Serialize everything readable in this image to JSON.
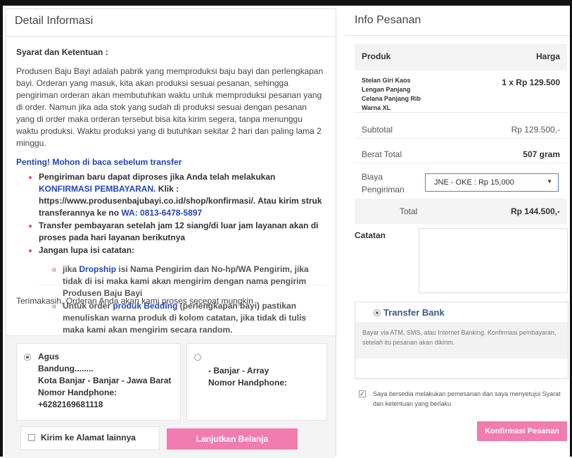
{
  "left_panel": {
    "title": "Detail Informasi",
    "syarat_heading": "Syarat dan Ketentuan :",
    "paragraph": "Produsen Baju Bayi adalah pabrik yang memproduksi baju bayi dan perlengkapan bayi. Orderan yang masuk, kita akan produksi sesuai pesanan, sehingga pengiriman orderan akan membutuhkan waktu untuk memproduksi pesanan yang di order. Namun jika ada stok yang sudah di produksi sesuai dengan pesanan yang di order maka orderan tersebut bisa kita kirim segera, tanpa menunggu waktu produksi. Waktu produksi yang di butuhkan sekitar 2 hari dan paling lama 2 minggu.",
    "penting": "Penting! Mohon di baca sebelum transfer",
    "rule1_a": "Pengiriman baru dapat diproses jika Anda telah melakukan ",
    "rule1_link": "KONFIRMASI PEMBAYARAN.",
    "rule1_b": " Klik : https://www.produsenbajubayi.co.id/shop/konfirmasi/. Atau kirim struk transferannya ke no ",
    "rule1_wa": "WA: 0813-6478-5897",
    "rule2": "Transfer pembayaran setelah jam 12 siang/di luar jam layanan akan di proses pada hari layanan berikutnya",
    "rule3": "Jangan lupa isi catatan:",
    "sub1_a": "jika ",
    "sub1_link": "Dropship",
    "sub1_b": " isi Nama Pengirim dan No-hp/WA Pengirim, jika tidak di isi maka kami akan mengirim dengan nama pengirim Produsen Baju Bayi",
    "sub2_a": "Untuk order ",
    "sub2_link": "produk Bedding",
    "sub2_b": " (perlengkapan bayi) pastikan menuliskan warna produk di kolom catatan, jika tidak di tulis maka kami akan mengirim secara random.",
    "thanks": "Terimakasih, Orderan Anda akan kami proses secepat mungkin"
  },
  "address1": {
    "name": "Agus",
    "line1": "Bandung........",
    "line2": "Kota Banjar - Banjar - Jawa Barat",
    "phone_label": "Nomor Handphone:",
    "phone": "+6282169681118"
  },
  "address2": {
    "line1": "- Banjar - Array",
    "phone_label": "Nomor Handphone:"
  },
  "kirim_label": "Kirim ke Alamat lainnya",
  "lanjutkan_label": "Lanjutkan Belanja",
  "right_panel": {
    "title": "Info Pesanan",
    "col_produk": "Produk",
    "col_harga": "Harga",
    "product_name": "Stelan Giri Kaos Lengan Panjang Celana Panjang Rib Warna XL",
    "product_price": "1 x Rp 129.500",
    "subtotal_label": "Subtotal",
    "subtotal_value": "Rp 129.500,-",
    "berat_label": "Berat Total",
    "berat_value": "507 gram",
    "biaya_label": "Biaya Pengiriman",
    "shipping_selected": "JNE - OKE : Rp 15,000",
    "total_label": "Total",
    "total_value": "Rp 144.500,-",
    "catatan_label": "Catatan",
    "transfer_label": "Transfer Bank",
    "transfer_desc": "Bayar via ATM, SMS, atau Internet Banking. Konfirmasi pembayaran, setelah itu pesanan akan dikirim.",
    "setuju_text": "Saya bersedia melakukan pemesanan dan saya menyetujui Syarat dan ketentuan yang berlaku",
    "konfirmasi_label": "Konfirmasi Pesanan"
  },
  "colors": {
    "accent_pink": "#f07cb0",
    "link_blue": "#2246b8",
    "bullet_red": "#d9534f"
  }
}
